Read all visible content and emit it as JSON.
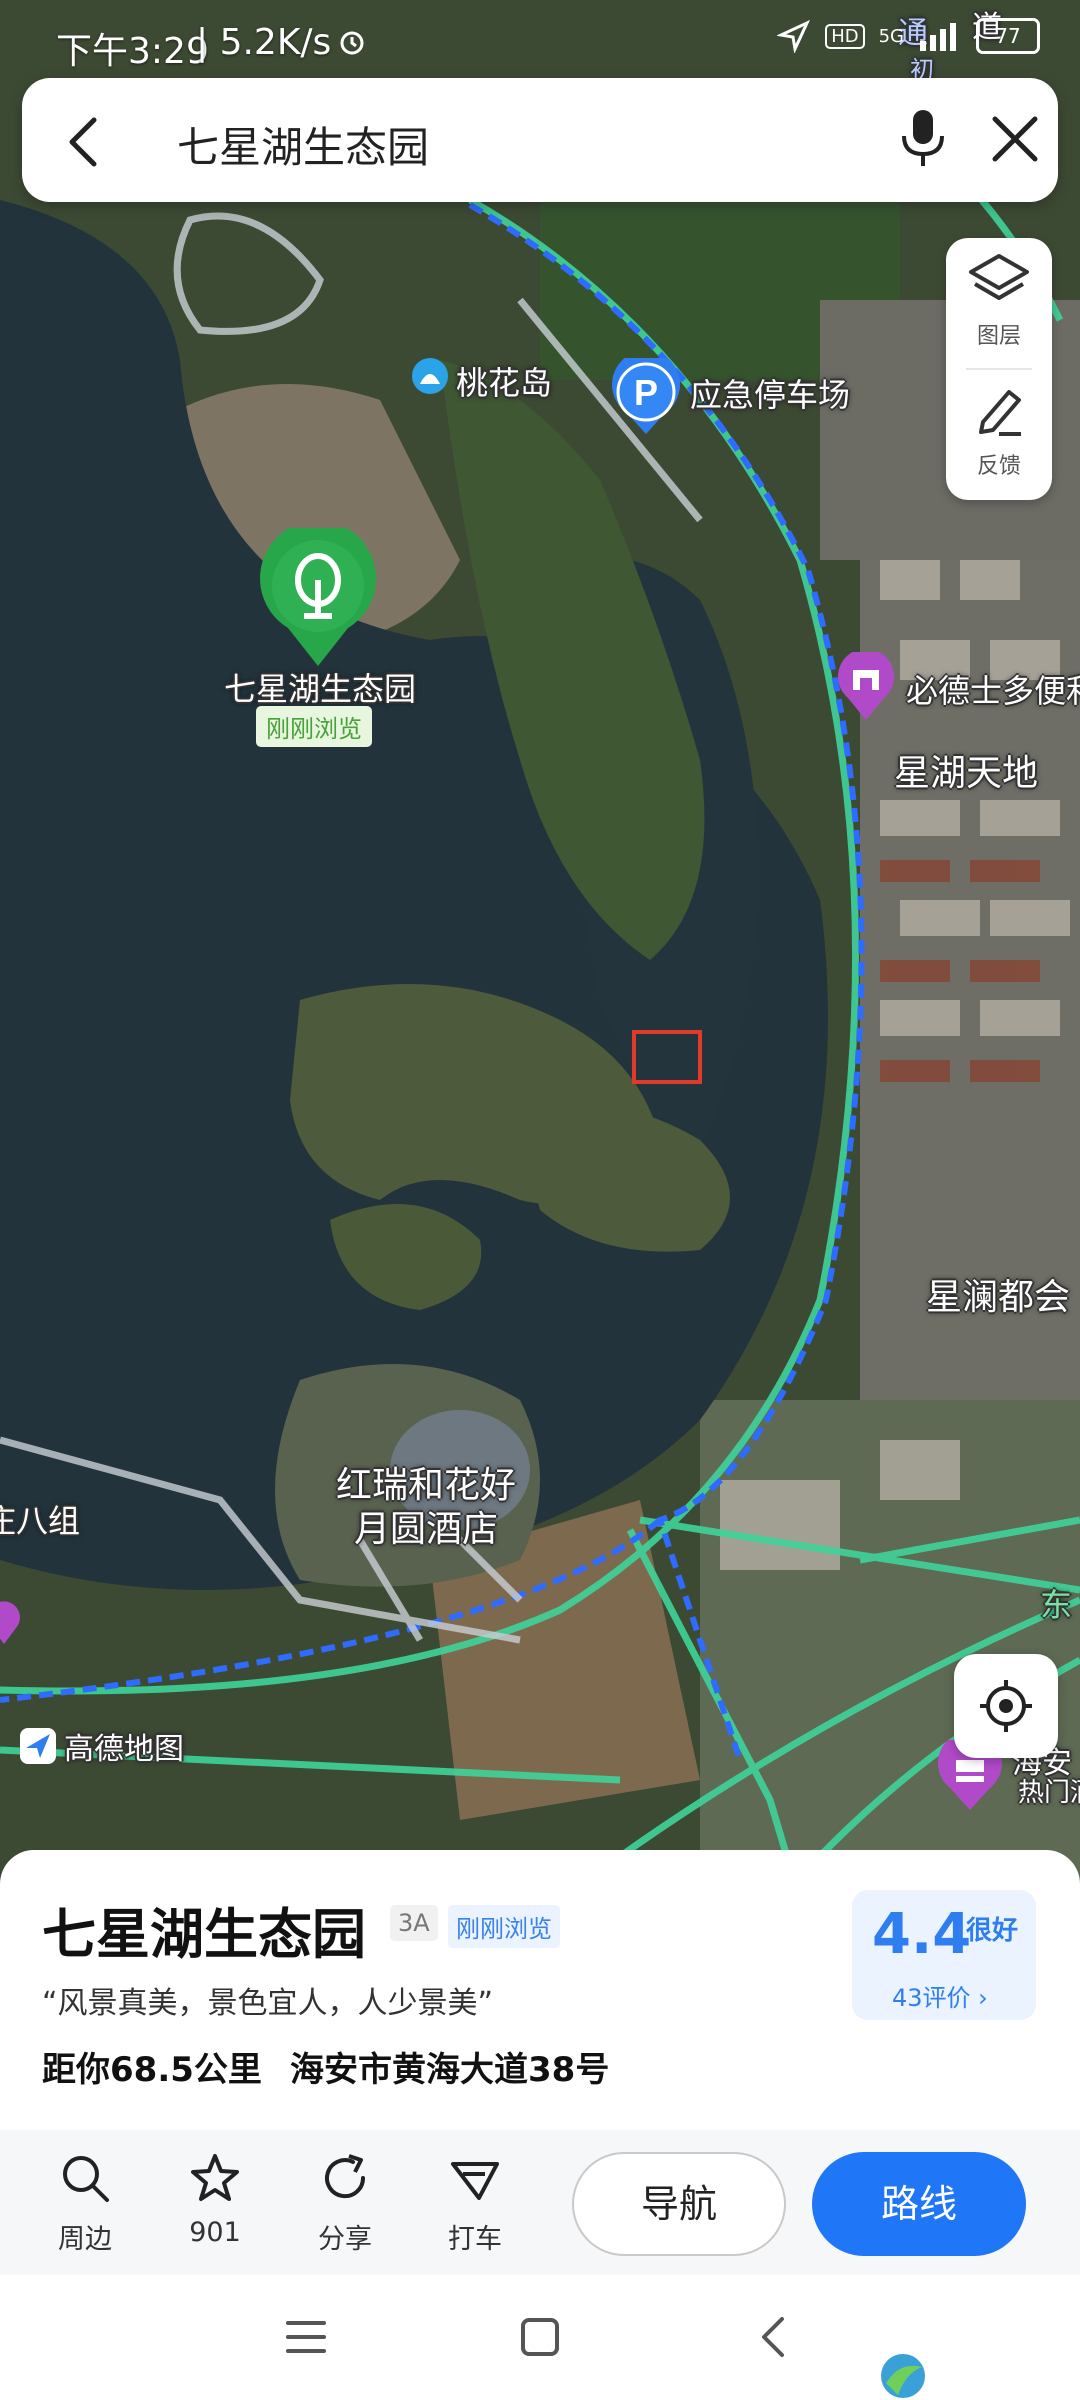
{
  "status_bar": {
    "time": "下午3:29",
    "network_speed": "| 5.2K/s",
    "signal": "5G",
    "hd": "HD",
    "battery": "77"
  },
  "search": {
    "query": "七星湖生态园"
  },
  "tools": {
    "layers_label": "图层",
    "feedback_label": "反馈"
  },
  "map": {
    "labels": {
      "peach_island": "桃花岛",
      "emergency_parking": "应急停车场",
      "poi_main": "七星湖生态园",
      "viewed_tag": "刚刚浏览",
      "store": "必德士多便利",
      "xinghu_tiandi": "星湖天地",
      "xinglan_duhui": "星澜都会",
      "hotel_line1": "红瑞和花好",
      "hotel_line2": "月圆酒店",
      "village": "庄八组",
      "road_east": "东",
      "haian_line1": "海安",
      "haian_line2": "热门酒",
      "road_top1": "通",
      "road_top2": "道",
      "road_top3": "初"
    },
    "logo_text": "高德地图"
  },
  "place": {
    "name": "七星湖生态园",
    "grade": "3A",
    "viewed": "刚刚浏览",
    "quote": "“风景真美，景色宜人，人少景美”",
    "distance": "距你68.5公里",
    "address": "海安市黄海大道38号",
    "rating": "4.4",
    "rating_grade": "很好",
    "reviews": "43评价 ›"
  },
  "actions": {
    "nearby": "周边",
    "favorites": "901",
    "share": "分享",
    "taxi": "打车",
    "navigate": "导航",
    "route": "路线"
  },
  "colors": {
    "accent": "#1f76f6",
    "poi_green": "#27a64a",
    "road_green": "#3fd49a",
    "boundary_blue": "#2f6bff",
    "water": "#22333c"
  }
}
